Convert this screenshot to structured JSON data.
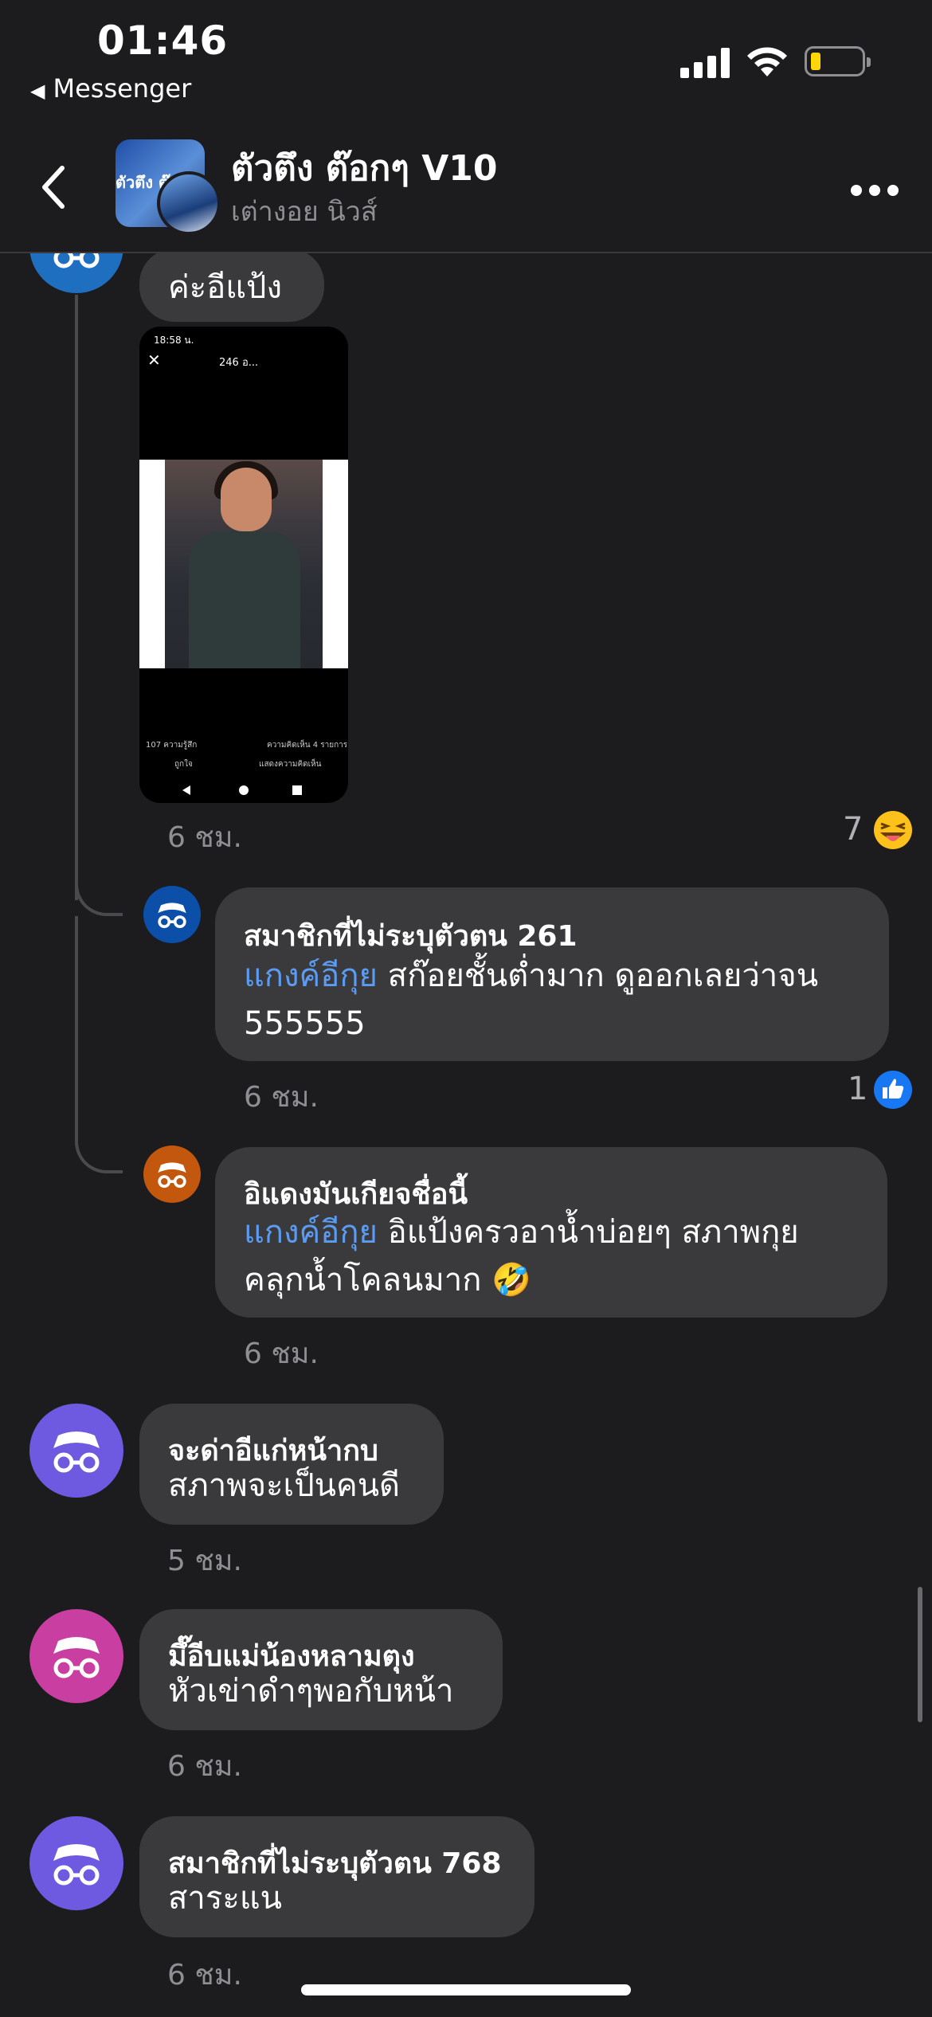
{
  "status_bar": {
    "time": "01:46",
    "back_app": "Messenger",
    "battery_color": "#ffd60a"
  },
  "header": {
    "title": "ตัวตึง ต๊อกๆ V10",
    "subtitle": "เต่างอย นิวส์",
    "avatar_text": "ตัวตึง ต๊"
  },
  "thread": {
    "root": {
      "text": "ค่ะอีแป้ง",
      "time": "6 ชม.",
      "reaction_count": "7",
      "reaction": "grinning-tongue-emoji",
      "image": {
        "status_time": "18:58 น.",
        "title": "246 อ...",
        "reactions_text": "107 ความรู้สึก",
        "comments_text": "ความคิดเห็น 4 รายการ",
        "like_label": "ถูกใจ",
        "comment_label": "แสดงความคิดเห็น"
      }
    },
    "replies": [
      {
        "name": "สมาชิกที่ไม่ระบุตัวตน 261",
        "mention": "แกงค์อีกุย",
        "line1": " สก๊อยชั้นต่ำมาก ดูออกเลยว่าจน",
        "line2": "555555",
        "time": "6 ชม.",
        "reaction_count": "1",
        "reaction": "like-icon",
        "avatar_color": "#0b4fa8"
      },
      {
        "name": "อิแดงมันเกียจชื่อนี้",
        "mention": "แกงค์อีกุย",
        "line1": "  อิแป้งครวอาน้ำบ่อยๆ สภาพกุย",
        "line2": "คลุกน้ำโคลนมาก 🤣",
        "time": "6 ชม.",
        "avatar_color": "#c2570d"
      }
    ]
  },
  "messages": [
    {
      "line1": "จะด่าอีแก่หน้ากบ",
      "line2": "สภาพจะเป็นคนดี",
      "time": "5 ชม.",
      "avatar_color": "#6e5ae0"
    },
    {
      "line1": "มึ๊อีบแม่น้องหลามตุง",
      "line2": "หัวเข่าดำๆพอกับหน้า",
      "time": "6 ชม.",
      "avatar_color": "#c93fa1"
    },
    {
      "line1": "สมาชิกที่ไม่ระบุตัวตน 768",
      "line2": "สาระแน",
      "time": "6 ชม.",
      "avatar_color": "#6e5ae0"
    }
  ]
}
